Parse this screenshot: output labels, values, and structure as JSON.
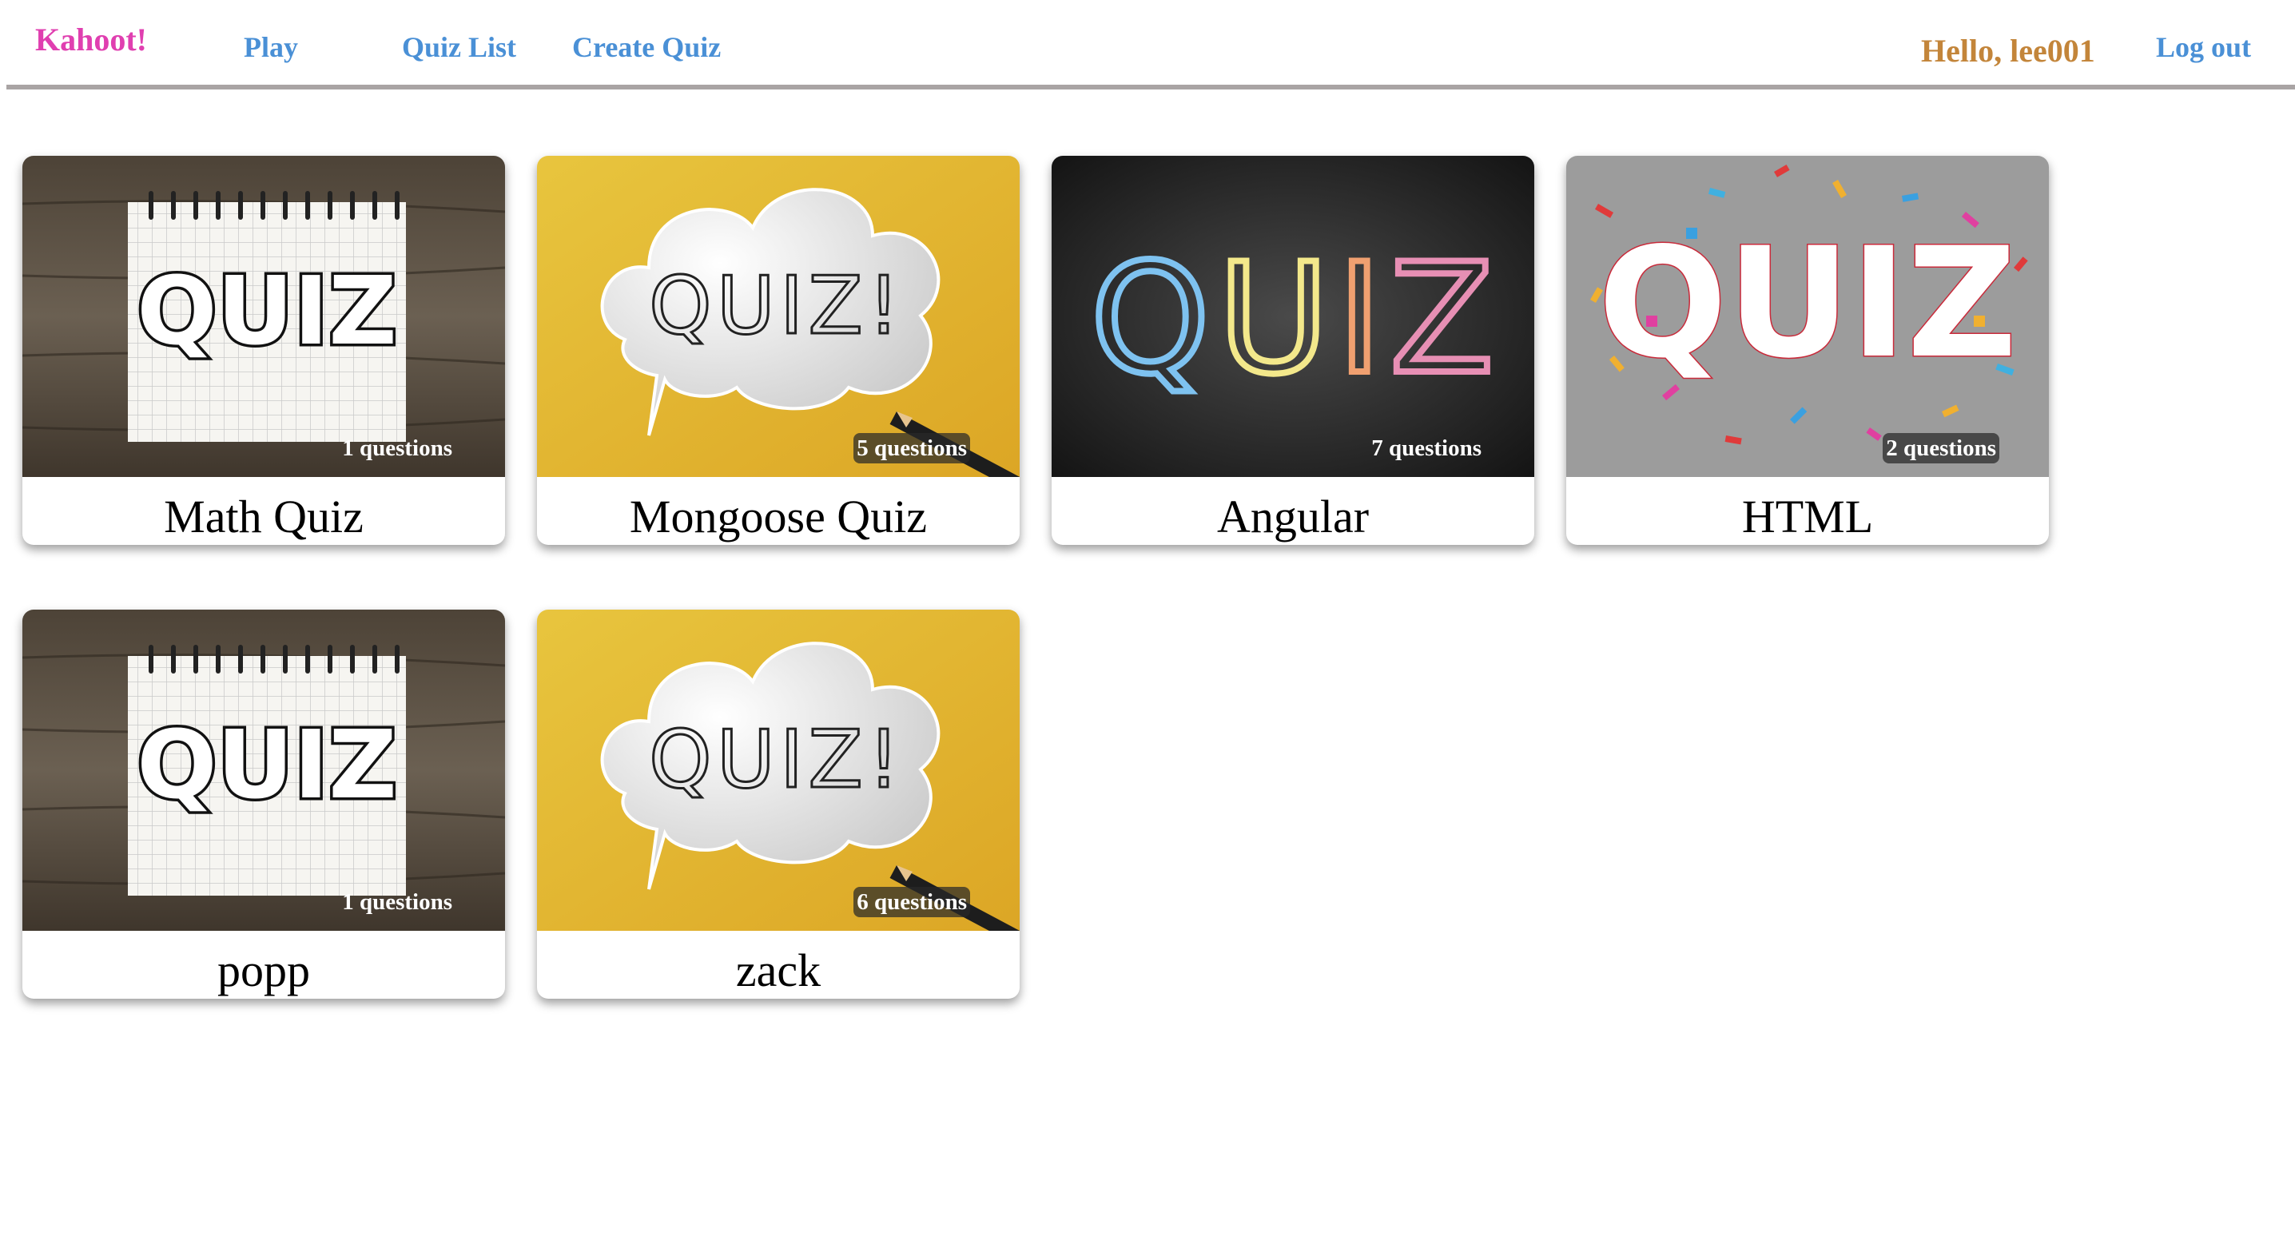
{
  "nav": {
    "brand": "Kahoot!",
    "links": [
      "Play",
      "Quiz List",
      "Create Quiz"
    ],
    "greeting": "Hello, lee001",
    "logout": "Log out"
  },
  "quizzes": [
    {
      "title": "Math Quiz",
      "questions": "1 questions",
      "image": "notebook-quiz-image"
    },
    {
      "title": "Mongoose Quiz",
      "questions": "5 questions",
      "image": "speech-bubble-quiz-image"
    },
    {
      "title": "Angular",
      "questions": "7 questions",
      "image": "chalkboard-quiz-image"
    },
    {
      "title": "HTML",
      "questions": "2 questions",
      "image": "confetti-quiz-image"
    },
    {
      "title": "popp",
      "questions": "1 questions",
      "image": "notebook-quiz-image"
    },
    {
      "title": "zack",
      "questions": "6 questions",
      "image": "speech-bubble-quiz-image"
    }
  ],
  "image_text": {
    "quiz_word": "QUIZ",
    "quiz_exclaim": "QUIZ!"
  },
  "colors": {
    "brand": "#e03fb0",
    "link": "#4a90d6",
    "greeting": "#c3853a",
    "rule": "#a9a4a4"
  }
}
